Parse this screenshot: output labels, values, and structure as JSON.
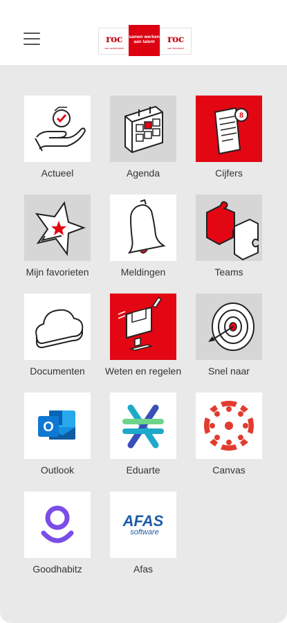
{
  "header": {
    "logo_left_word": "roc",
    "logo_right_word": "roc",
    "logo_left_sub": "van amsterdam",
    "logo_right_sub": "van flevoland",
    "logo_center_text": "samen werken aan talent"
  },
  "tiles": [
    {
      "label": "Actueel",
      "icon": "hand-check-icon"
    },
    {
      "label": "Agenda",
      "icon": "calendar-icon"
    },
    {
      "label": "Cijfers",
      "icon": "grades-document-icon"
    },
    {
      "label": "Mijn favorieten",
      "icon": "star-icon"
    },
    {
      "label": "Meldingen",
      "icon": "bell-icon"
    },
    {
      "label": "Teams",
      "icon": "puzzle-icon"
    },
    {
      "label": "Documenten",
      "icon": "cloud-icon"
    },
    {
      "label": "Weten en regelen",
      "icon": "computer-icon"
    },
    {
      "label": "Snel naar",
      "icon": "target-icon"
    },
    {
      "label": "Outlook",
      "icon": "outlook-icon"
    },
    {
      "label": "Eduarte",
      "icon": "eduarte-icon"
    },
    {
      "label": "Canvas",
      "icon": "canvas-icon"
    },
    {
      "label": "Goodhabitz",
      "icon": "goodhabitz-icon"
    },
    {
      "label": "Afas",
      "icon": "afas-icon"
    }
  ],
  "afas": {
    "word": "AFAS",
    "sub": "software"
  },
  "outlook_letter": "O",
  "colors": {
    "brand_red": "#e30613",
    "tile_grey": "#d6d6d6",
    "background": "#e9e9e9"
  }
}
